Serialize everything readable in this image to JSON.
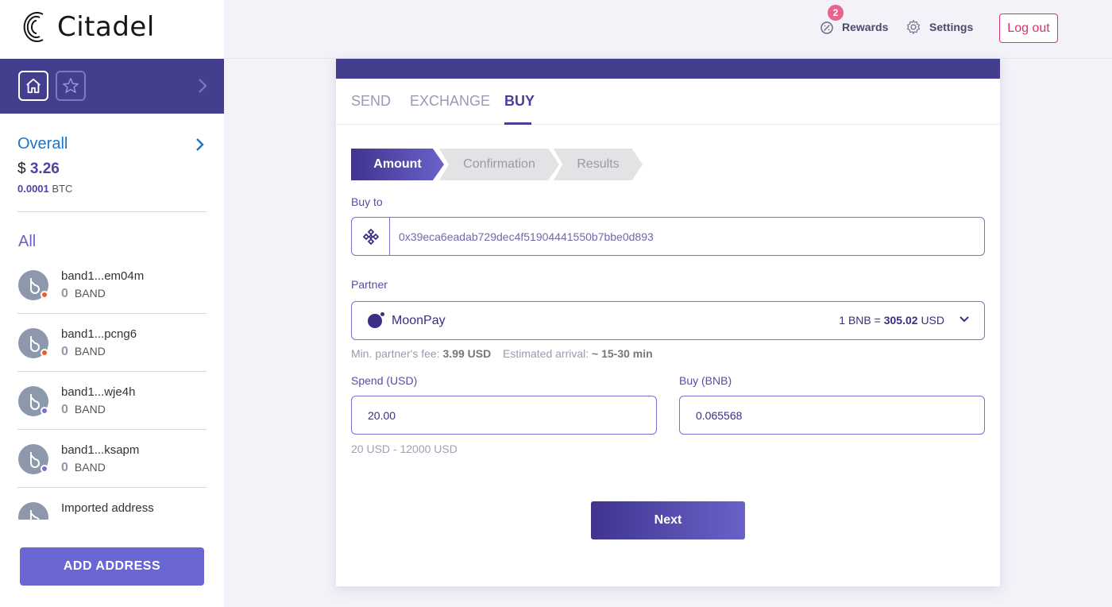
{
  "app": {
    "name": "Citadel"
  },
  "sidebar": {
    "overall_label": "Overall",
    "balance_symbol": "$",
    "balance_usd": "3.26",
    "balance_btc": "0.0001",
    "btc_unit": "BTC",
    "all_label": "All",
    "addresses": [
      {
        "name": "band1...em04m",
        "amount": "0",
        "unit": "BAND",
        "dot_color": "#f05a28"
      },
      {
        "name": "band1...pcng6",
        "amount": "0",
        "unit": "BAND",
        "dot_color": "#f05a28"
      },
      {
        "name": "band1...wje4h",
        "amount": "0",
        "unit": "BAND",
        "dot_color": "#7b6fd6"
      },
      {
        "name": "band1...ksapm",
        "amount": "0",
        "unit": "BAND",
        "dot_color": "#7b6fd6"
      },
      {
        "name": "Imported address",
        "amount": "",
        "unit": "",
        "dot_color": ""
      }
    ],
    "add_button": "ADD ADDRESS"
  },
  "header": {
    "rewards_label": "Rewards",
    "rewards_badge": "2",
    "settings_label": "Settings",
    "logout_label": "Log out"
  },
  "tabs": [
    {
      "label": "SEND",
      "active": false
    },
    {
      "label": "EXCHANGE",
      "active": false
    },
    {
      "label": "BUY",
      "active": true
    }
  ],
  "steps": [
    "Amount",
    "Confirmation",
    "Results"
  ],
  "form": {
    "buy_to_label": "Buy to",
    "buy_to_address": "0x39eca6eadab729dec4f51904441550b7bbe0d893",
    "partner_label": "Partner",
    "partner_name": "MoonPay",
    "rate_prefix": "1 BNB =",
    "rate_value": "305.02",
    "rate_unit": "USD",
    "fee_label": "Min. partner's fee:",
    "fee_value": "3.99 USD",
    "arrival_label": "Estimated arrival:",
    "arrival_value": "~ 15-30 min",
    "spend_label": "Spend (USD)",
    "spend_value": "20.00",
    "buy_label": "Buy (BNB)",
    "buy_value": "0.065568",
    "range_hint": "20 USD - 12000 USD",
    "next_button": "Next"
  },
  "colors": {
    "brand": "#443e8f",
    "accent": "#6a66d3",
    "logout": "#d6336c"
  }
}
